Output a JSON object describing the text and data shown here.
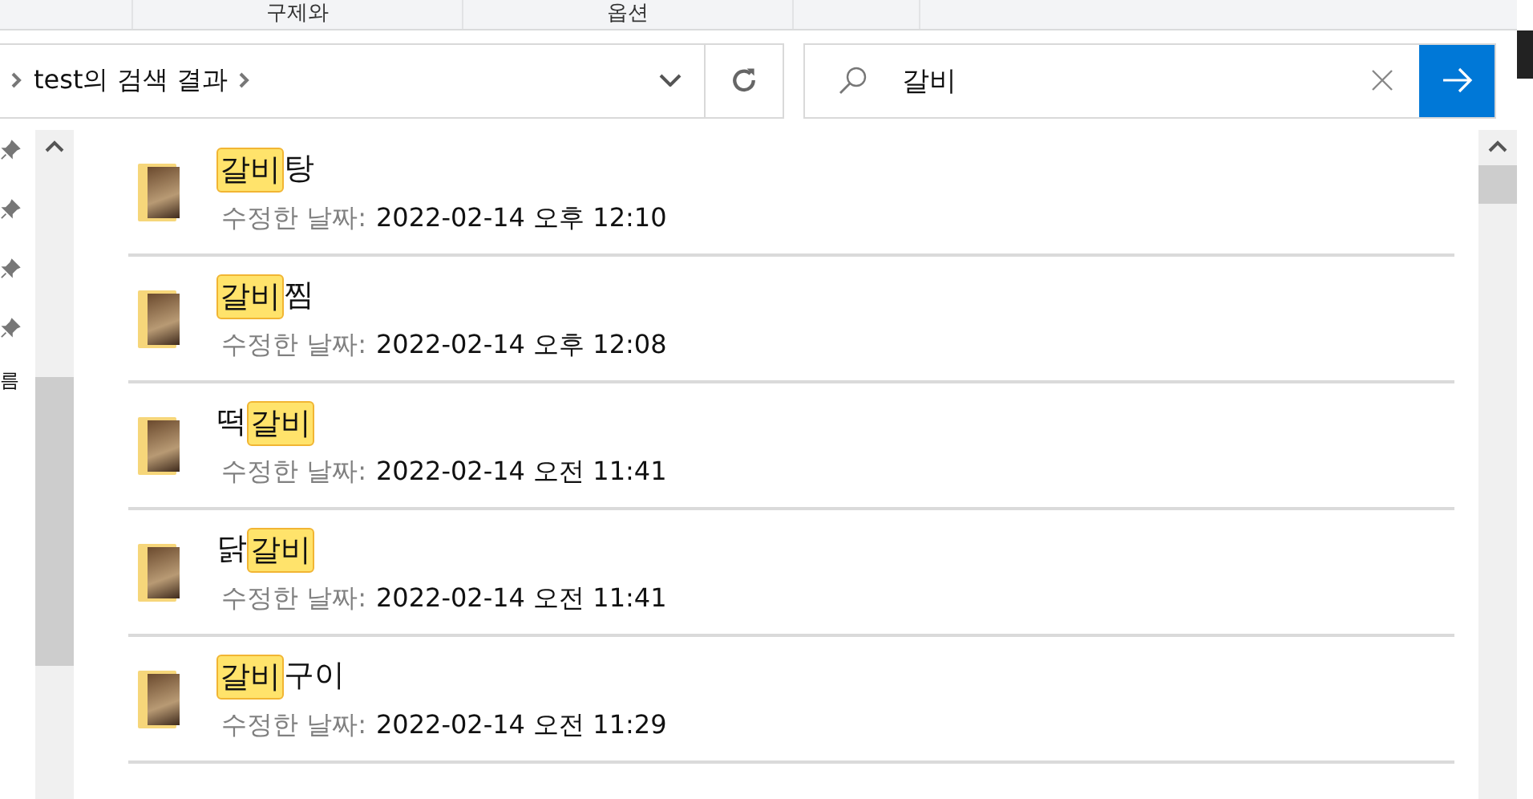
{
  "ribbon": {
    "tabs": [
      {
        "label": "구제와",
        "selected": false
      },
      {
        "label": "옵션",
        "selected": false
      }
    ]
  },
  "address_bar": {
    "path": "test의 검색 결과"
  },
  "search": {
    "value": "갈비"
  },
  "nav_pane": {
    "items": [
      {
        "pinned": true
      },
      {
        "pinned": true
      },
      {
        "pinned": true
      },
      {
        "pinned": true
      }
    ],
    "cut_text": "름"
  },
  "results": [
    {
      "name": [
        {
          "text": "갈비",
          "highlighted": true
        },
        {
          "text": "탕",
          "highlighted": false
        }
      ],
      "date_label": "수정한 날짜:",
      "date": "2022-02-14 오후 12:10"
    },
    {
      "name": [
        {
          "text": "갈비",
          "highlighted": true
        },
        {
          "text": "찜",
          "highlighted": false
        }
      ],
      "date_label": "수정한 날짜:",
      "date": "2022-02-14 오후 12:08"
    },
    {
      "name": [
        {
          "text": "떡",
          "highlighted": false
        },
        {
          "text": "갈비",
          "highlighted": true
        }
      ],
      "date_label": "수정한 날짜:",
      "date": "2022-02-14 오전 11:41"
    },
    {
      "name": [
        {
          "text": "닭",
          "highlighted": false
        },
        {
          "text": "갈비",
          "highlighted": true
        }
      ],
      "date_label": "수정한 날짜:",
      "date": "2022-02-14 오전 11:41"
    },
    {
      "name": [
        {
          "text": "갈비",
          "highlighted": true
        },
        {
          "text": "구이",
          "highlighted": false
        }
      ],
      "date_label": "수정한 날짜:",
      "date": "2022-02-14 오전 11:29"
    }
  ]
}
